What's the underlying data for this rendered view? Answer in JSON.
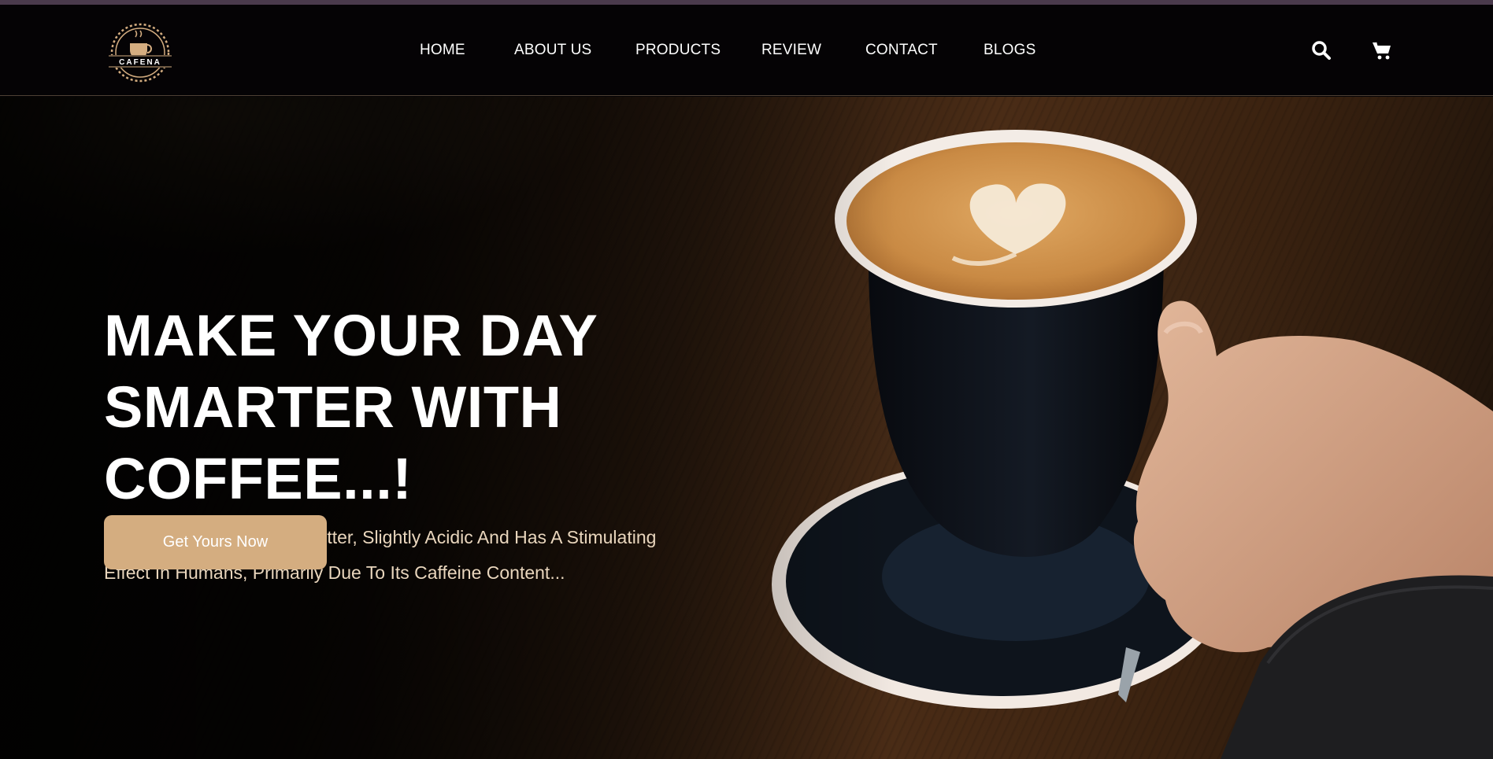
{
  "logo": {
    "text": "CAFENA",
    "accent": "#d4ad80"
  },
  "nav": {
    "items": [
      {
        "label": "HOME"
      },
      {
        "label": "ABOUT US"
      },
      {
        "label": "PRODUCTS"
      },
      {
        "label": "REVIEW"
      },
      {
        "label": "CONTACT"
      },
      {
        "label": "BLOGS"
      }
    ],
    "icons": [
      "search-icon",
      "cart-icon"
    ]
  },
  "hero": {
    "title_lines": [
      "MAKE YOUR DAY",
      "SMARTER WITH",
      "COFFEE...!"
    ],
    "text_lines": [
      "Coffee Is Darkly Colored, Bitter, Slightly Acidic And Has A Stimulating",
      "Effect In Humans, Primarily Due To Its Caffeine Content..."
    ],
    "cta_label": "Get Yours Now"
  },
  "colors": {
    "accent": "#d4ad80",
    "nav_background": "#050305",
    "text_light": "#ffffff"
  }
}
